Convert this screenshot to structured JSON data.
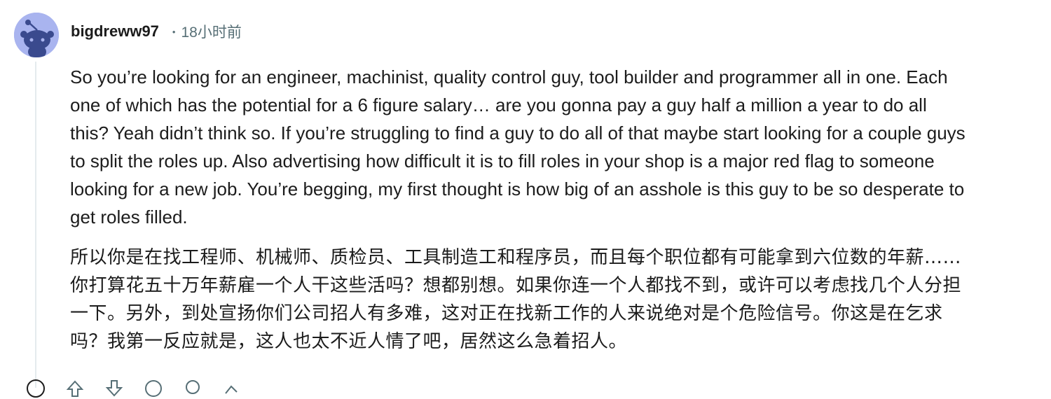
{
  "comment": {
    "author": "bigdreww97",
    "separator": "•",
    "timestamp": "18小时前",
    "paragraph_en": "So you’re looking for an engineer, machinist, quality control guy, tool builder and programmer all in one. Each one of which has the potential for a 6 figure salary… are you gonna pay a guy half a million a year to do all this? Yeah didn’t think so. If you’re struggling to find a guy to do all of that maybe start looking for a couple guys to split the roles up. Also advertising how difficult it is to fill roles in your shop is a major red flag to someone looking for a new job. You’re begging, my first thought is how big of an asshole is this guy to be so desperate to get roles filled.",
    "paragraph_zh": "所以你是在找工程师、机械师、质检员、工具制造工和程序员，而且每个职位都有可能拿到六位数的年薪……你打算花五十万年薪雇一个人干这些活吗？想都别想。如果你连一个人都找不到，或许可以考虑找几个人分担一下。另外，到处宣扬你们公司招人有多难，这对正在找新工作的人来说绝对是个危险信号。你这是在乞求吗？我第一反应就是，这人也太不近人情了吧，居然这么急着招人。"
  },
  "colors": {
    "avatar_bg": "#a9b4ef",
    "meta_text": "#576f76",
    "thread_line": "#e5ebee"
  },
  "action_icons": [
    "collapse-icon",
    "upvote-icon",
    "downvote-icon",
    "reply-icon",
    "award-icon",
    "share-icon"
  ]
}
